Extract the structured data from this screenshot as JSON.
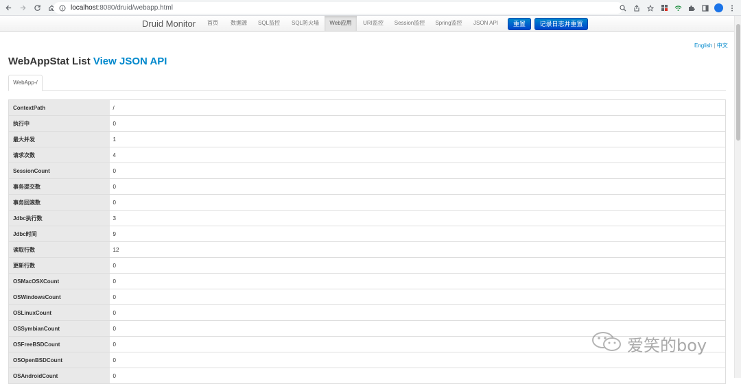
{
  "browser": {
    "url_host": "localhost",
    "url_rest": ":8080/druid/webapp.html",
    "icons": [
      "back-icon",
      "forward-icon",
      "reload-icon",
      "home-icon",
      "info-icon",
      "zoom-icon",
      "share-icon",
      "star-icon",
      "extension-icon",
      "wifi-icon",
      "puzzle-icon",
      "sidepanel-icon",
      "profile-icon",
      "menu-icon"
    ]
  },
  "navbar": {
    "brand": "Druid Monitor",
    "items": [
      {
        "label": "首页"
      },
      {
        "label": "数据源"
      },
      {
        "label": "SQL监控"
      },
      {
        "label": "SQL防火墙"
      },
      {
        "label": "Web应用"
      },
      {
        "label": "URI监控"
      },
      {
        "label": "Session监控"
      },
      {
        "label": "Spring监控"
      },
      {
        "label": "JSON API"
      }
    ],
    "reset_label": "重置",
    "reset_log_label": "记录日志并重置"
  },
  "lang": {
    "english": "English",
    "sep": "|",
    "chinese": "中文"
  },
  "page": {
    "title": "WebAppStat List",
    "api_link": "View JSON API",
    "tab_label": "WebApp-/"
  },
  "stats": [
    {
      "key": "ContextPath",
      "value": "/"
    },
    {
      "key": "执行中",
      "value": "0"
    },
    {
      "key": "最大并发",
      "value": "1"
    },
    {
      "key": "请求次数",
      "value": "4"
    },
    {
      "key": "SessionCount",
      "value": "0"
    },
    {
      "key": "事务提交数",
      "value": "0"
    },
    {
      "key": "事务回滚数",
      "value": "0"
    },
    {
      "key": "Jdbc执行数",
      "value": "3"
    },
    {
      "key": "Jdbc时间",
      "value": "9"
    },
    {
      "key": "读取行数",
      "value": "12"
    },
    {
      "key": "更新行数",
      "value": "0"
    },
    {
      "key": "OSMacOSXCount",
      "value": "0"
    },
    {
      "key": "OSWindowsCount",
      "value": "0"
    },
    {
      "key": "OSLinuxCount",
      "value": "0"
    },
    {
      "key": "OSSymbianCount",
      "value": "0"
    },
    {
      "key": "OSFreeBSDCount",
      "value": "0"
    },
    {
      "key": "OSOpenBSDCount",
      "value": "0"
    },
    {
      "key": "OSAndroidCount",
      "value": "0"
    }
  ],
  "watermark": {
    "text": "爱笑的boy"
  }
}
